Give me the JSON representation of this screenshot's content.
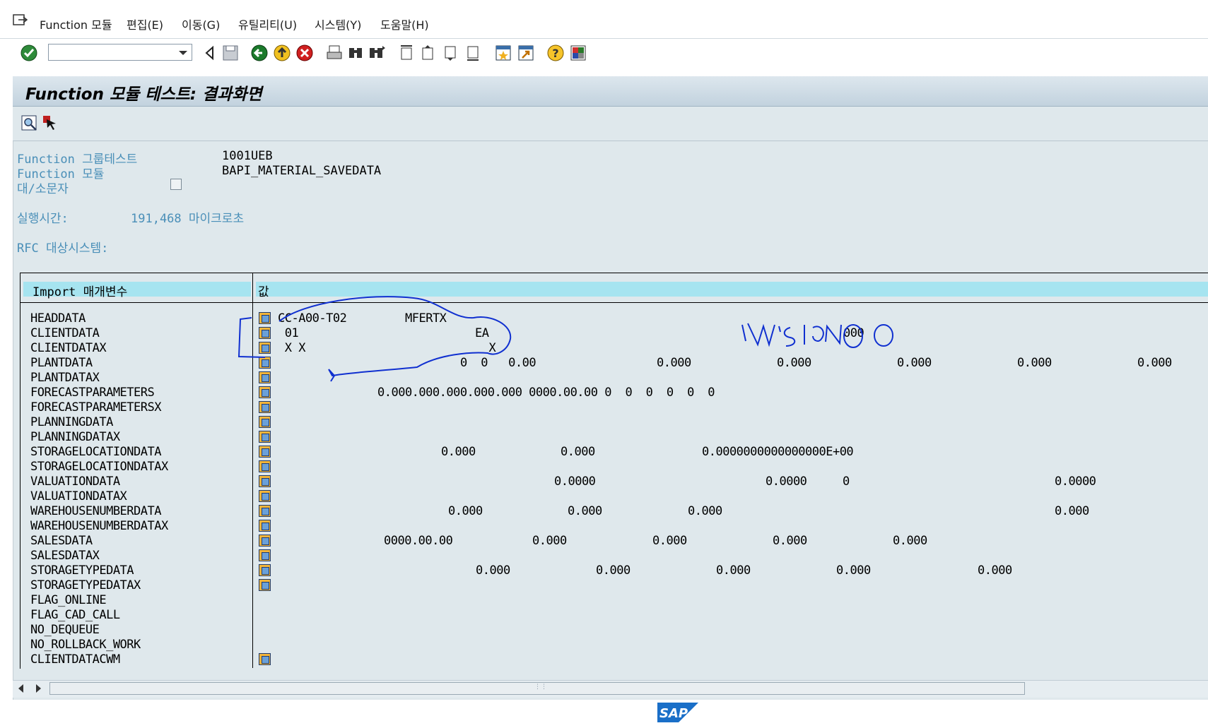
{
  "menu": {
    "items": [
      "Function 모듈",
      "편집(E)",
      "이동(G)",
      "유틸리티(U)",
      "시스템(Y)",
      "도움말(H)"
    ]
  },
  "toolbar": {
    "command_field_value": "",
    "icons": [
      "enter-check-icon",
      "back-arrow-icon",
      "save-icon",
      "back-green-icon",
      "exit-yellow-icon",
      "cancel-red-icon",
      "print-icon",
      "find-icon",
      "find-next-icon",
      "first-page-icon",
      "prev-page-icon",
      "next-page-icon",
      "last-page-icon",
      "new-session-icon",
      "shortcut-icon",
      "help-icon",
      "layout-icon"
    ]
  },
  "title": "Function 모듈 테스트: 결과화면",
  "header": {
    "group_label": "Function 그룹테스트",
    "group_value": "1001UEB",
    "module_label": "Function 모듈",
    "module_value": "BAPI_MATERIAL_SAVEDATA",
    "case_label": "대/소문자",
    "runtime_label": "실행시간:",
    "runtime_value": "191,468 마이크로초",
    "rfc_label": "RFC 대상시스템:"
  },
  "table": {
    "col_param": "Import 매개변수",
    "col_value": "값",
    "rows": [
      {
        "name": "HEADDATA",
        "icon": true,
        "cells": [
          {
            "col": 0,
            "text": "CC-A00-T02"
          },
          {
            "col": 1,
            "text": "MFERTX"
          }
        ]
      },
      {
        "name": "CLIENTDATA",
        "icon": true,
        "cells": [
          {
            "col": 0,
            "text": " 01"
          },
          {
            "col": 2,
            "text": "EA"
          },
          {
            "col": 3,
            "text": "000"
          }
        ]
      },
      {
        "name": "CLIENTDATAX",
        "icon": true,
        "cells": [
          {
            "col": 0,
            "text": " X X"
          },
          {
            "col": 2,
            "text": "  X"
          }
        ]
      },
      {
        "name": "PLANTDATA",
        "icon": true,
        "cells": [
          {
            "col": 4,
            "text": "0  0   0.00"
          },
          {
            "col": 5,
            "text": "0.000"
          },
          {
            "col": 6,
            "text": "0.000"
          },
          {
            "col": 7,
            "text": "0.000"
          },
          {
            "col": 8,
            "text": "0.000"
          },
          {
            "col": 9,
            "text": "0.000"
          }
        ]
      },
      {
        "name": "PLANTDATAX",
        "icon": true,
        "cells": []
      },
      {
        "name": "FORECASTPARAMETERS",
        "icon": true,
        "cells": [
          {
            "col": 10,
            "text": "0.000.000.000.000.000 0000.00.00 0  0  0  0  0  0"
          }
        ]
      },
      {
        "name": "FORECASTPARAMETERSX",
        "icon": true,
        "cells": []
      },
      {
        "name": "PLANNINGDATA",
        "icon": true,
        "cells": []
      },
      {
        "name": "PLANNINGDATAX",
        "icon": true,
        "cells": []
      },
      {
        "name": "STORAGELOCATIONDATA",
        "icon": true,
        "cells": [
          {
            "col": 11,
            "text": "0.000"
          },
          {
            "col": 12,
            "text": "0.000"
          },
          {
            "col": 13,
            "text": "0.0000000000000000E+00"
          }
        ]
      },
      {
        "name": "STORAGELOCATIONDATAX",
        "icon": true,
        "cells": []
      },
      {
        "name": "VALUATIONDATA",
        "icon": true,
        "cells": [
          {
            "col": 14,
            "text": "0.0000"
          },
          {
            "col": 15,
            "text": "0.0000"
          },
          {
            "col": 16,
            "text": "0"
          },
          {
            "col": 17,
            "text": "0.0000"
          }
        ]
      },
      {
        "name": "VALUATIONDATAX",
        "icon": true,
        "cells": []
      },
      {
        "name": "WAREHOUSENUMBERDATA",
        "icon": true,
        "cells": [
          {
            "col": 18,
            "text": "0.000"
          },
          {
            "col": 19,
            "text": "0.000"
          },
          {
            "col": 20,
            "text": "0.000"
          },
          {
            "col": 17,
            "text": "0.000"
          }
        ]
      },
      {
        "name": "WAREHOUSENUMBERDATAX",
        "icon": true,
        "cells": []
      },
      {
        "name": "SALESDATA",
        "icon": true,
        "cells": [
          {
            "col": 21,
            "text": "0000.00.00"
          },
          {
            "col": 22,
            "text": "0.000"
          },
          {
            "col": 23,
            "text": "0.000"
          },
          {
            "col": 24,
            "text": "0.000"
          },
          {
            "col": 25,
            "text": "0.000"
          }
        ]
      },
      {
        "name": "SALESDATAX",
        "icon": true,
        "cells": []
      },
      {
        "name": "STORAGETYPEDATA",
        "icon": true,
        "cells": [
          {
            "col": 26,
            "text": "0.000"
          },
          {
            "col": 27,
            "text": "0.000"
          },
          {
            "col": 28,
            "text": "0.000"
          },
          {
            "col": 29,
            "text": "0.000"
          },
          {
            "col": 30,
            "text": "0.000"
          }
        ]
      },
      {
        "name": "STORAGETYPEDATAX",
        "icon": true,
        "cells": []
      },
      {
        "name": "FLAG_ONLINE",
        "icon": false,
        "cells": []
      },
      {
        "name": "FLAG_CAD_CALL",
        "icon": false,
        "cells": []
      },
      {
        "name": "NO_DEQUEUE",
        "icon": false,
        "cells": []
      },
      {
        "name": "NO_ROLLBACK_WORK",
        "icon": false,
        "cells": []
      },
      {
        "name": "CLIENTDATACWM",
        "icon": true,
        "cells": []
      }
    ]
  },
  "colors": {
    "header_band": "#a6e4f0",
    "frame_bg": "#dfe8ec",
    "label_blue": "#4a8fb8",
    "ink_annotation": "#1030d0"
  }
}
